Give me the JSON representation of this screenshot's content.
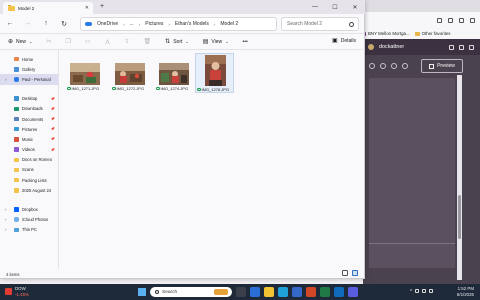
{
  "explorer": {
    "tab_title": "Model 2",
    "tab_close": "✕",
    "new_tab": "+",
    "window_controls": [
      "—",
      "☐",
      "✕"
    ],
    "breadcrumb": [
      "OneDrive",
      "...",
      "Pictures",
      "Ethan's Models",
      "Model 2"
    ],
    "search_placeholder": "Search Model 2",
    "toolbar": {
      "new_label": "New",
      "sort_label": "Sort",
      "view_label": "View",
      "more_label": "•••",
      "details_label": "Details"
    },
    "sidebar": {
      "top": [
        {
          "label": "Home",
          "icon": "home-icon"
        },
        {
          "label": "Gallery",
          "icon": "gallery-icon"
        },
        {
          "label": "Paul - Personal",
          "icon": "onedrive-icon",
          "selected": true
        }
      ],
      "quick": [
        {
          "label": "Desktop",
          "icon": "desktop-icon"
        },
        {
          "label": "Downloads",
          "icon": "downloads-icon"
        },
        {
          "label": "Documents",
          "icon": "documents-icon"
        },
        {
          "label": "Pictures",
          "icon": "pictures-icon"
        },
        {
          "label": "Music",
          "icon": "music-icon"
        },
        {
          "label": "Videos",
          "icon": "videos-icon"
        },
        {
          "label": "Docs on Romeo",
          "icon": "folder-icon"
        },
        {
          "label": "Scans",
          "icon": "folder-icon"
        },
        {
          "label": "Packing Lists",
          "icon": "folder-icon"
        },
        {
          "label": "2025 August 24",
          "icon": "folder-icon"
        }
      ],
      "bottom": [
        {
          "label": "Dropbox",
          "icon": "dropbox-icon"
        },
        {
          "label": "iCloud Photos",
          "icon": "icloud-icon"
        },
        {
          "label": "This PC",
          "icon": "pc-icon"
        }
      ]
    },
    "files": [
      {
        "name": "IMG_1271.JPG",
        "selected": false
      },
      {
        "name": "IMG_1272.JPG",
        "selected": false
      },
      {
        "name": "IMG_1274.JPG",
        "selected": false
      },
      {
        "name": "IMG_1276.JPG",
        "selected": true
      }
    ],
    "status": "4 items"
  },
  "background_app": {
    "favorites_label": "Other favorites",
    "tab_bank": "BNY Mellon Mortga...",
    "app_name": "dockattner",
    "preview_label": "Preview"
  },
  "taskbar": {
    "weather_title": "DOW",
    "weather_value": "-1.45%",
    "search_placeholder": "Search",
    "time": "1:52 PM",
    "date": "8/1/2025"
  }
}
